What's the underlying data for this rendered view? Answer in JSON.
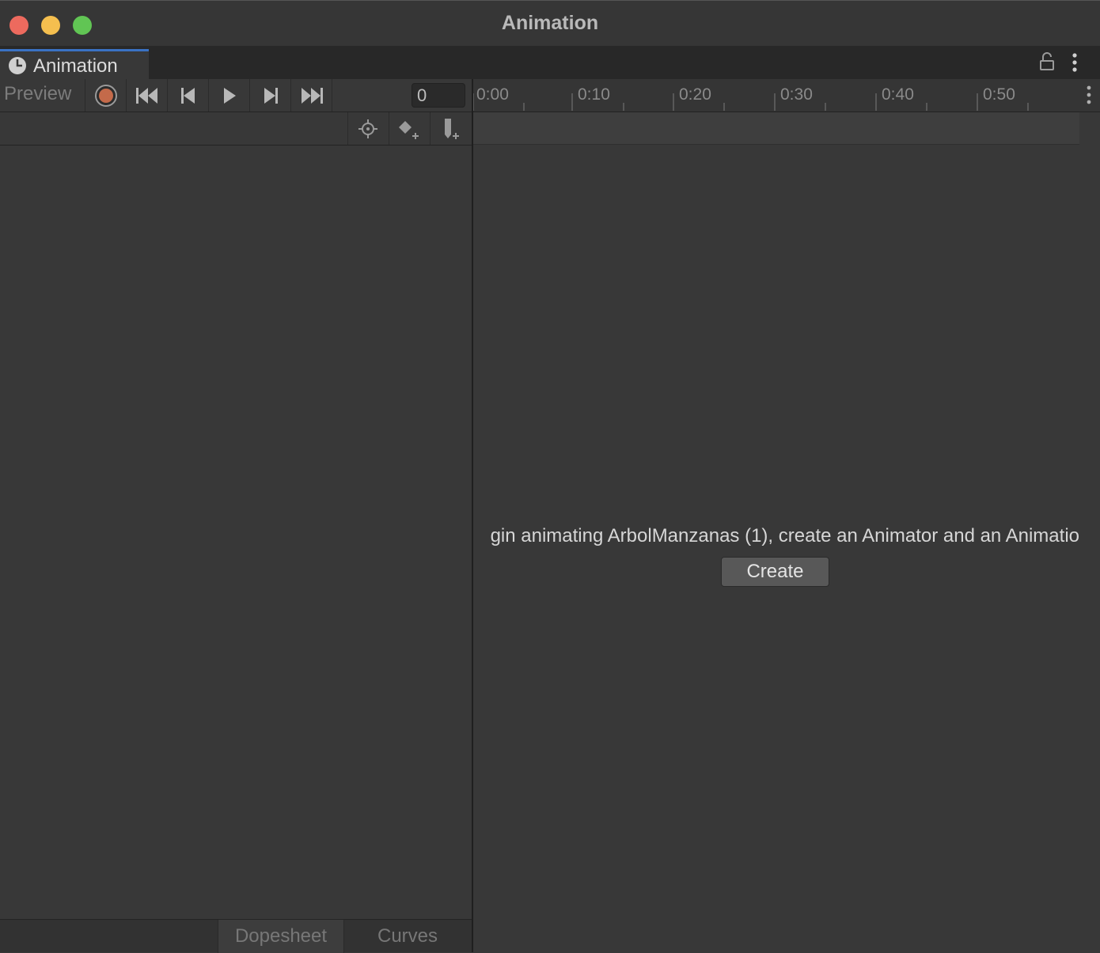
{
  "window": {
    "title": "Animation"
  },
  "tab": {
    "label": "Animation"
  },
  "toolbar": {
    "preview_label": "Preview",
    "frame_value": "0"
  },
  "ruler": {
    "labels": [
      "0:00",
      "0:10",
      "0:20",
      "0:30",
      "0:40",
      "0:50"
    ]
  },
  "message": {
    "text": "gin animating ArbolManzanas (1), create an Animator and an Animatio",
    "create_label": "Create"
  },
  "bottom_tabs": {
    "dopesheet": "Dopesheet",
    "curves": "Curves",
    "active": "Dopesheet"
  },
  "colors": {
    "record": "#c46a4a",
    "tab_accent": "#3a72c4"
  },
  "icons": [
    "clock-icon",
    "lock-icon",
    "more-options-icon",
    "record-icon",
    "first-frame-icon",
    "prev-frame-icon",
    "play-icon",
    "next-frame-icon",
    "last-frame-icon",
    "filter-target-icon",
    "add-keyframe-icon",
    "add-event-icon"
  ]
}
